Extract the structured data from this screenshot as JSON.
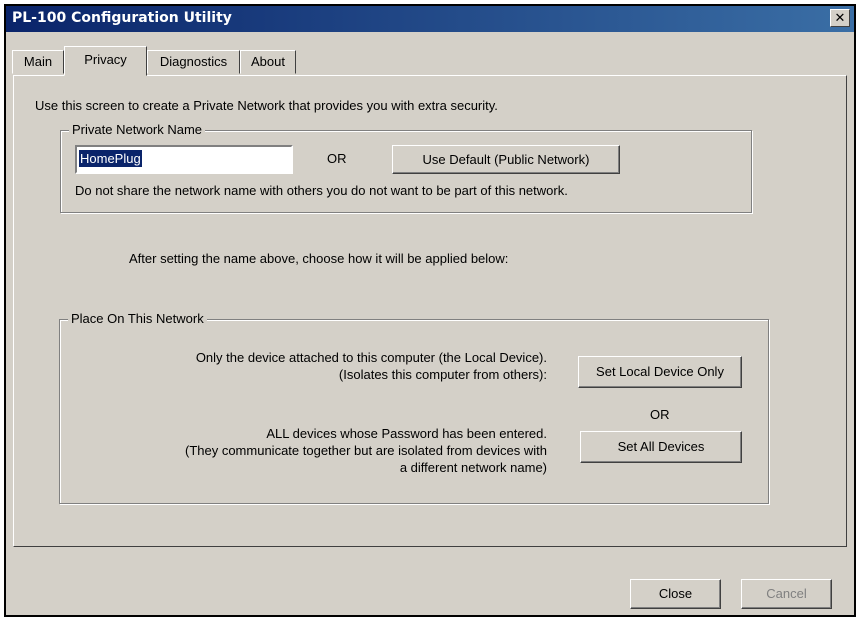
{
  "window": {
    "title": "PL-100 Configuration Utility",
    "close_glyph": "✕"
  },
  "tabs": [
    {
      "label": "Main",
      "active": false
    },
    {
      "label": "Privacy",
      "active": true
    },
    {
      "label": "Diagnostics",
      "active": false
    },
    {
      "label": "About",
      "active": false
    }
  ],
  "privacy": {
    "intro": "Use this screen to create a Private Network that provides you with extra security.",
    "network_name_group": {
      "legend": "Private Network Name",
      "name_value": "HomePlug",
      "or_label": "OR",
      "default_button": "Use Default (Public Network)",
      "hint": "Do not share the network name with others you do not want to be part of this network."
    },
    "after_text": "After setting the name above, choose how it will be applied below:",
    "place_group": {
      "legend": "Place On This Network",
      "local_line1": "Only the device attached to this computer (the Local Device).",
      "local_line2": "(Isolates this computer from others):",
      "local_button": "Set Local Device Only",
      "or_label": "OR",
      "all_line1": "ALL devices whose Password has been entered.",
      "all_line2": "(They communicate together but are isolated from devices with",
      "all_line3": "a different network name)",
      "all_button": "Set All Devices"
    }
  },
  "footer": {
    "close_button": "Close",
    "cancel_button": "Cancel"
  },
  "colors": {
    "face": "#d4d0c8",
    "title_start": "#0a246a",
    "title_end": "#3a6ea5",
    "selection": "#0a246a"
  }
}
